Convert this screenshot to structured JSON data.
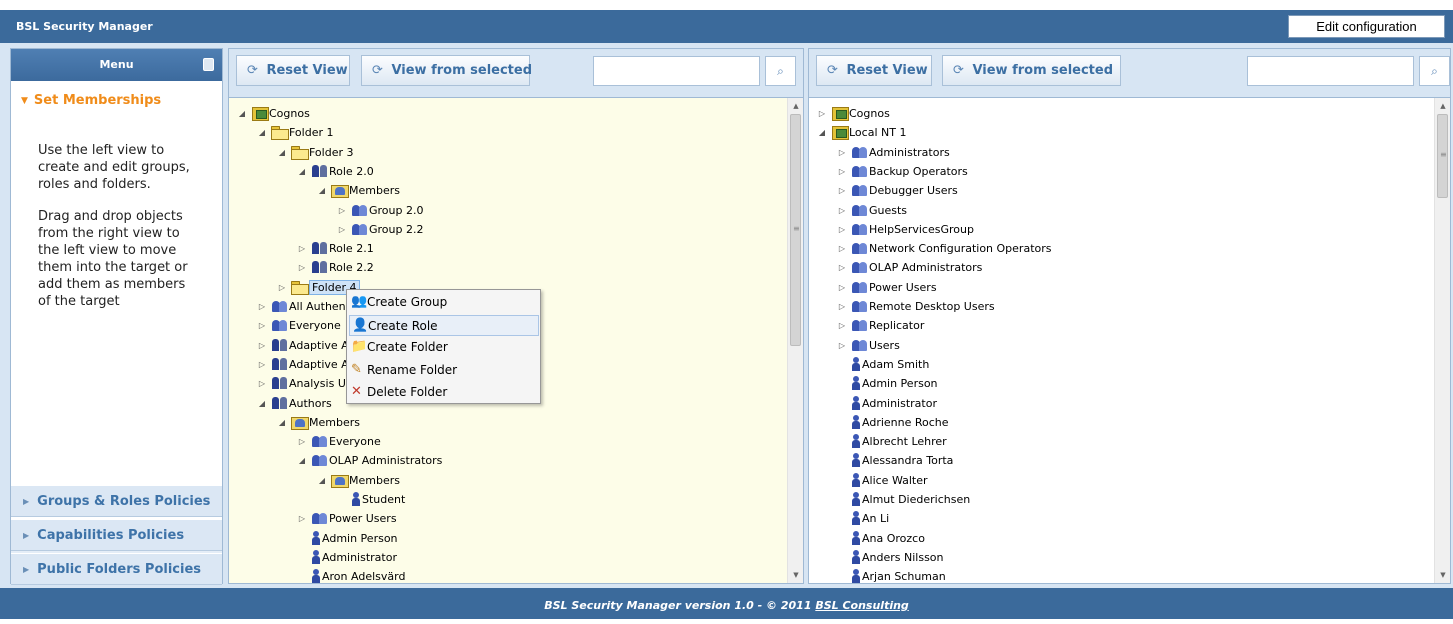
{
  "header": {
    "title": "BSL Security Manager",
    "edit_button": "Edit configuration"
  },
  "menu": {
    "title": "Menu",
    "active_section": "Set Memberships",
    "text1": "Use the left view to\ncreate and edit groups,\nroles and folders.",
    "text2": "Drag and drop objects\nfrom the right view to\nthe left view to move\nthem into the target or\nadd them as members\nof the target",
    "items": [
      "Groups & Roles Policies",
      "Capabilities Policies",
      "Public Folders Policies"
    ]
  },
  "left_panel": {
    "reset_label": "Reset View",
    "view_label": "View from selected",
    "search_value": ""
  },
  "right_panel": {
    "reset_label": "Reset View",
    "view_label": "View from selected",
    "search_value": ""
  },
  "left_tree": [
    {
      "label": "Cognos",
      "icon": "cfold",
      "level": 0,
      "toggle": "open"
    },
    {
      "label": "Folder 1",
      "icon": "folder",
      "level": 1,
      "toggle": "open"
    },
    {
      "label": "Folder 3",
      "icon": "folder",
      "level": 2,
      "toggle": "open"
    },
    {
      "label": "Role 2.0",
      "icon": "role",
      "level": 3,
      "toggle": "open"
    },
    {
      "label": "Members",
      "icon": "mfold",
      "level": 4,
      "toggle": "open"
    },
    {
      "label": "Group 2.0",
      "icon": "group",
      "level": 5,
      "toggle": "closed"
    },
    {
      "label": "Group 2.2",
      "icon": "group",
      "level": 5,
      "toggle": "closed"
    },
    {
      "label": "Role 2.1",
      "icon": "role",
      "level": 3,
      "toggle": "closed"
    },
    {
      "label": "Role 2.2",
      "icon": "role",
      "level": 3,
      "toggle": "closed"
    },
    {
      "label": "Folder 4",
      "icon": "folder",
      "level": 2,
      "toggle": "closed",
      "selected": true
    },
    {
      "label": "All Authen",
      "icon": "group",
      "level": 1,
      "toggle": "closed"
    },
    {
      "label": "Everyone",
      "icon": "group",
      "level": 1,
      "toggle": "closed"
    },
    {
      "label": "Adaptive A",
      "icon": "role",
      "level": 1,
      "toggle": "closed"
    },
    {
      "label": "Adaptive A",
      "icon": "role",
      "level": 1,
      "toggle": "closed"
    },
    {
      "label": "Analysis U",
      "icon": "role",
      "level": 1,
      "toggle": "closed"
    },
    {
      "label": "Authors",
      "icon": "role",
      "level": 1,
      "toggle": "open"
    },
    {
      "label": "Members",
      "icon": "mfold",
      "level": 2,
      "toggle": "open"
    },
    {
      "label": "Everyone",
      "icon": "group",
      "level": 3,
      "toggle": "closed"
    },
    {
      "label": "OLAP Administrators",
      "icon": "group",
      "level": 3,
      "toggle": "open"
    },
    {
      "label": "Members",
      "icon": "mfold",
      "level": 4,
      "toggle": "open"
    },
    {
      "label": "Student",
      "icon": "user",
      "level": 5,
      "toggle": "none"
    },
    {
      "label": "Power Users",
      "icon": "group",
      "level": 3,
      "toggle": "closed"
    },
    {
      "label": "Admin Person",
      "icon": "user",
      "level": 3,
      "toggle": "none"
    },
    {
      "label": "Administrator",
      "icon": "user",
      "level": 3,
      "toggle": "none"
    },
    {
      "label": "Aron Adelsvärd",
      "icon": "user",
      "level": 3,
      "toggle": "none"
    }
  ],
  "right_tree": [
    {
      "label": "Cognos",
      "icon": "cfold",
      "level": 0,
      "toggle": "closed"
    },
    {
      "label": "Local NT 1",
      "icon": "cfold",
      "level": 0,
      "toggle": "open"
    },
    {
      "label": "Administrators",
      "icon": "group",
      "level": 1,
      "toggle": "closed"
    },
    {
      "label": "Backup Operators",
      "icon": "group",
      "level": 1,
      "toggle": "closed"
    },
    {
      "label": "Debugger Users",
      "icon": "group",
      "level": 1,
      "toggle": "closed"
    },
    {
      "label": "Guests",
      "icon": "group",
      "level": 1,
      "toggle": "closed"
    },
    {
      "label": "HelpServicesGroup",
      "icon": "group",
      "level": 1,
      "toggle": "closed"
    },
    {
      "label": "Network Configuration Operators",
      "icon": "group",
      "level": 1,
      "toggle": "closed"
    },
    {
      "label": "OLAP Administrators",
      "icon": "group",
      "level": 1,
      "toggle": "closed"
    },
    {
      "label": "Power Users",
      "icon": "group",
      "level": 1,
      "toggle": "closed"
    },
    {
      "label": "Remote Desktop Users",
      "icon": "group",
      "level": 1,
      "toggle": "closed"
    },
    {
      "label": "Replicator",
      "icon": "group",
      "level": 1,
      "toggle": "closed"
    },
    {
      "label": "Users",
      "icon": "group",
      "level": 1,
      "toggle": "closed"
    },
    {
      "label": "Adam Smith",
      "icon": "user",
      "level": 1,
      "toggle": "none"
    },
    {
      "label": "Admin Person",
      "icon": "user",
      "level": 1,
      "toggle": "none"
    },
    {
      "label": "Administrator",
      "icon": "user",
      "level": 1,
      "toggle": "none"
    },
    {
      "label": "Adrienne Roche",
      "icon": "user",
      "level": 1,
      "toggle": "none"
    },
    {
      "label": "Albrecht Lehrer",
      "icon": "user",
      "level": 1,
      "toggle": "none"
    },
    {
      "label": "Alessandra Torta",
      "icon": "user",
      "level": 1,
      "toggle": "none"
    },
    {
      "label": "Alice Walter",
      "icon": "user",
      "level": 1,
      "toggle": "none"
    },
    {
      "label": "Almut Diederichsen",
      "icon": "user",
      "level": 1,
      "toggle": "none"
    },
    {
      "label": "An Li",
      "icon": "user",
      "level": 1,
      "toggle": "none"
    },
    {
      "label": "Ana Orozco",
      "icon": "user",
      "level": 1,
      "toggle": "none"
    },
    {
      "label": "Anders Nilsson",
      "icon": "user",
      "level": 1,
      "toggle": "none"
    },
    {
      "label": "Arjan Schuman",
      "icon": "user",
      "level": 1,
      "toggle": "none"
    }
  ],
  "context_menu": [
    {
      "label": "Create Group",
      "icon": "create-group-icon"
    },
    {
      "label": "Create Role",
      "icon": "create-role-icon",
      "hover": true
    },
    {
      "label": "Create Folder",
      "icon": "create-folder-icon"
    },
    {
      "label": "Rename Folder",
      "icon": "pencil-icon"
    },
    {
      "label": "Delete Folder",
      "icon": "red-x-icon"
    }
  ],
  "footer": {
    "text": "BSL Security Manager version 1.0 - © 2011 ",
    "link": "BSL Consulting"
  }
}
